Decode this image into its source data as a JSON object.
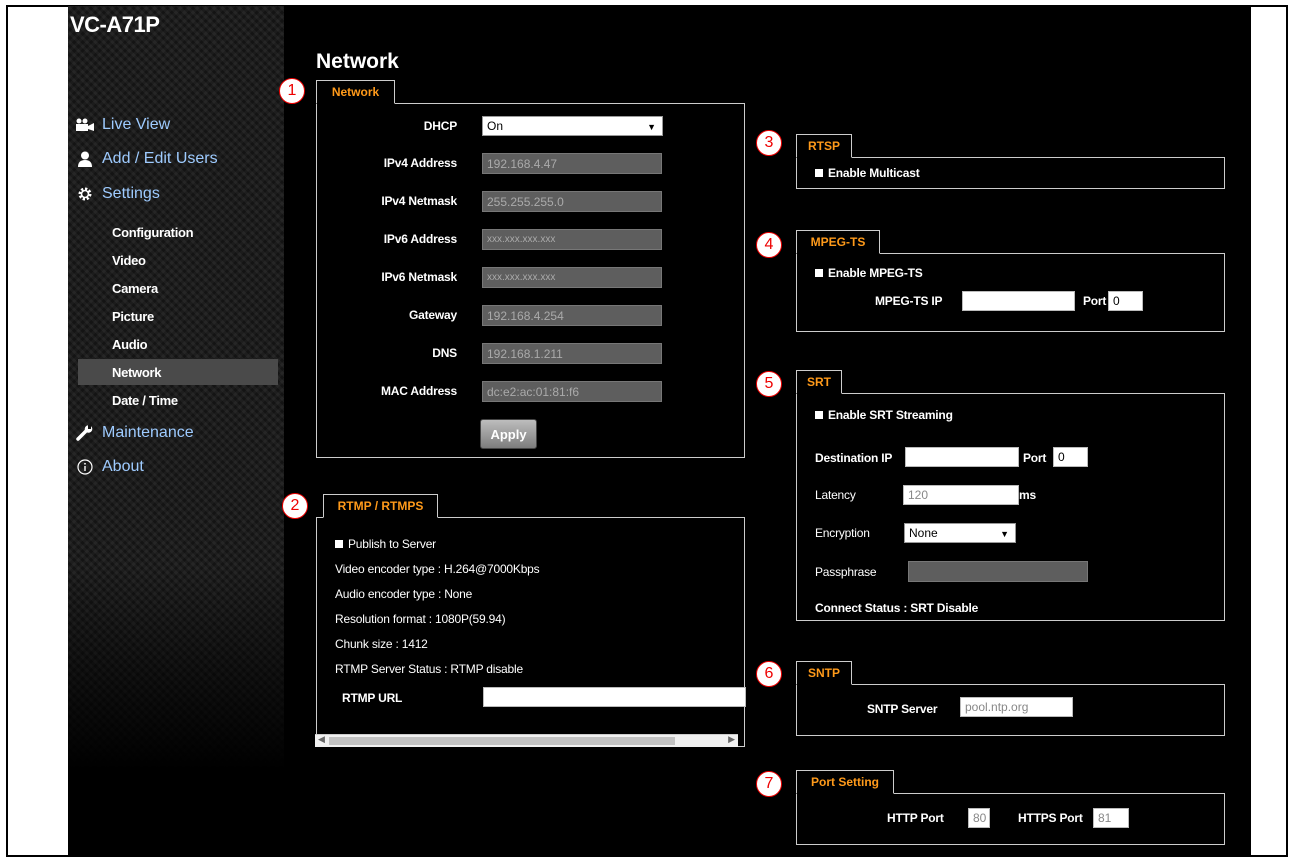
{
  "app": {
    "brand": "VC-A71P"
  },
  "nav": {
    "main": [
      {
        "label": "Live View",
        "icon": "camera-icon"
      },
      {
        "label": "Add / Edit Users",
        "icon": "user-icon"
      },
      {
        "label": "Settings",
        "icon": "gear-icon"
      },
      {
        "label": "Maintenance",
        "icon": "wrench-icon"
      },
      {
        "label": "About",
        "icon": "info-icon"
      }
    ],
    "sub": [
      "Configuration",
      "Video",
      "Camera",
      "Picture",
      "Audio",
      "Network",
      "Date / Time"
    ],
    "active": "Network"
  },
  "page": {
    "title": "Network"
  },
  "callouts": [
    "1",
    "2",
    "3",
    "4",
    "5",
    "6",
    "7"
  ],
  "network": {
    "tab": "Network",
    "dhcp_label": "DHCP",
    "dhcp_value": "On",
    "ipv4_label": "IPv4 Address",
    "ipv4_value": "192.168.4.47",
    "mask_label": "IPv4 Netmask",
    "mask_value": "255.255.255.0",
    "ipv6_label": "IPv6 Address",
    "ipv6_value": "xxx.xxx.xxx.xxx",
    "ipv6mask_label": "IPv6 Netmask",
    "ipv6mask_value": "xxx.xxx.xxx.xxx",
    "gateway_label": "Gateway",
    "gateway_value": "192.168.4.254",
    "dns_label": "DNS",
    "dns_value": "192.168.1.211",
    "mac_label": "MAC Address",
    "mac_value": "dc:e2:ac:01:81:f6",
    "apply": "Apply"
  },
  "rtmp": {
    "tab": "RTMP / RTMPS",
    "publish": "Publish to Server",
    "video_enc": "Video encoder type : H.264@7000Kbps",
    "audio_enc": "Audio encoder type : None",
    "resolution": "Resolution format : 1080P(59.94)",
    "chunk": "Chunk size : 1412",
    "status": "RTMP Server Status : RTMP disable",
    "url_label": "RTMP URL",
    "url_value": ""
  },
  "rtsp": {
    "tab": "RTSP",
    "multicast": "Enable Multicast"
  },
  "mpegts": {
    "tab": "MPEG-TS",
    "enable": "Enable MPEG-TS",
    "ip_label": "MPEG-TS IP",
    "ip_value": "",
    "port_label": "Port",
    "port_value": "0"
  },
  "srt": {
    "tab": "SRT",
    "enable": "Enable SRT Streaming",
    "dest_label": "Destination IP",
    "dest_value": "",
    "port_label": "Port",
    "port_value": "0",
    "latency_label": "Latency",
    "latency_value": "120",
    "latency_unit": "ms",
    "enc_label": "Encryption",
    "enc_value": "None",
    "pass_label": "Passphrase",
    "pass_value": "",
    "status": "Connect Status : SRT Disable"
  },
  "sntp": {
    "tab": "SNTP",
    "server_label": "SNTP Server",
    "server_value": "pool.ntp.org"
  },
  "port": {
    "tab": "Port Setting",
    "http_label": "HTTP Port",
    "http_value": "80",
    "https_label": "HTTPS Port",
    "https_value": "81"
  },
  "colors": {
    "tab_accent": "#ff9a1a",
    "nav_link": "#9ecbff",
    "callout": "#e00000"
  }
}
